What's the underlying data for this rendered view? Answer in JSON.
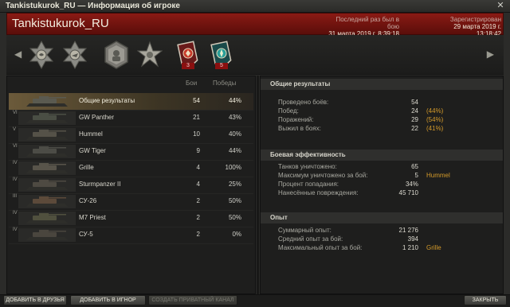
{
  "window": {
    "title": "Tankistukurok_RU — Информация об игроке",
    "close_glyph": "✕"
  },
  "header": {
    "player_name": "Tankistukurok_RU",
    "last_battle_label": "Последний раз был в бою",
    "last_battle_value": "31 марта 2019 г. 8:39:18",
    "registered_label": "Зарегистрирован",
    "registered_value": "29 марта 2019 г. 13:18:42"
  },
  "medals": {
    "items": [
      {
        "icon": "cross-medal-icon-1"
      },
      {
        "icon": "cross-medal-icon-2"
      },
      {
        "icon": "class-badge-icon"
      },
      {
        "icon": "star-medal-icon"
      },
      {
        "icon": "red-achievement-icon",
        "count": "3"
      },
      {
        "icon": "teal-achievement-icon",
        "count": "5"
      }
    ]
  },
  "table": {
    "col_battles": "Бои",
    "col_wins": "Победы",
    "rows": [
      {
        "tier": "",
        "name": "Общие результаты",
        "battles": "54",
        "wins": "44%",
        "selected": true
      },
      {
        "tier": "VI",
        "name": "GW Panther",
        "battles": "21",
        "wins": "43%"
      },
      {
        "tier": "V",
        "name": "Hummel",
        "battles": "10",
        "wins": "40%"
      },
      {
        "tier": "VI",
        "name": "GW Tiger",
        "battles": "9",
        "wins": "44%"
      },
      {
        "tier": "IV",
        "name": "Grille",
        "battles": "4",
        "wins": "100%"
      },
      {
        "tier": "IV",
        "name": "Sturmpanzer II",
        "battles": "4",
        "wins": "25%"
      },
      {
        "tier": "III",
        "name": "СУ-26",
        "battles": "2",
        "wins": "50%"
      },
      {
        "tier": "IV",
        "name": "M7 Priest",
        "battles": "2",
        "wins": "50%"
      },
      {
        "tier": "IV",
        "name": "СУ-5",
        "battles": "2",
        "wins": "0%"
      }
    ]
  },
  "stats": {
    "general": {
      "title": "Общие результаты",
      "rows": [
        {
          "label": "Проведено боёв:",
          "value": "54",
          "extra": ""
        },
        {
          "label": "Побед:",
          "value": "24",
          "extra": "(44%)"
        },
        {
          "label": "Поражений:",
          "value": "29",
          "extra": "(54%)"
        },
        {
          "label": "Выжил в боях:",
          "value": "22",
          "extra": "(41%)"
        }
      ]
    },
    "combat": {
      "title": "Боевая эффективность",
      "rows": [
        {
          "label": "Танков уничтожено:",
          "value": "65",
          "extra": ""
        },
        {
          "label": "Максимум уничтожено за бой:",
          "value": "5",
          "extra": "Hummel"
        },
        {
          "label": "Процент попадания:",
          "value": "34%",
          "extra": ""
        },
        {
          "label": "Нанесённые повреждения:",
          "value": "45 710",
          "extra": ""
        }
      ]
    },
    "exp": {
      "title": "Опыт",
      "rows": [
        {
          "label": "Суммарный опыт:",
          "value": "21 276",
          "extra": ""
        },
        {
          "label": "Средний опыт за бой:",
          "value": "394",
          "extra": ""
        },
        {
          "label": "Максимальный опыт за бой:",
          "value": "1 210",
          "extra": "Grille"
        }
      ]
    }
  },
  "footer": {
    "add_friend": "ДОБАВИТЬ В ДРУЗЬЯ",
    "add_ignore": "ДОБАВИТЬ В ИГНОР",
    "create_channel": "СОЗДАТЬ ПРИВАТНЫЙ КАНАЛ",
    "close": "ЗАКРЫТЬ"
  }
}
